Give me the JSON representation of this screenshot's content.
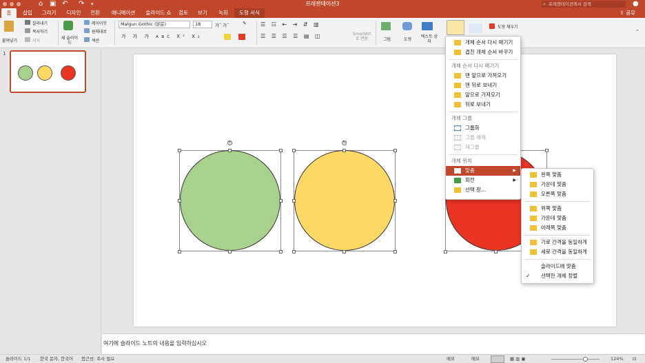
{
  "window": {
    "title": "프레젠테이션3",
    "search_placeholder": "프레젠테이션에서 검색",
    "share_label": "공유"
  },
  "tabs": [
    {
      "label": "홈",
      "active": true
    },
    {
      "label": "삽입"
    },
    {
      "label": "그리기"
    },
    {
      "label": "디자인"
    },
    {
      "label": "전환"
    },
    {
      "label": "애니메이션"
    },
    {
      "label": "슬라이드 쇼"
    },
    {
      "label": "검토"
    },
    {
      "label": "보기"
    },
    {
      "label": "녹화"
    },
    {
      "label": "도형 서식"
    }
  ],
  "ribbon": {
    "paste": "붙여넣기",
    "cut": "잘라내기",
    "copy": "복사하기",
    "format": "서식",
    "new_slide": "새 슬라이드",
    "layout": "레이아웃",
    "reset": "원래대로",
    "section": "섹션",
    "font_name": "Malgun Gothic (본문)",
    "font_size": "18",
    "smartart": "SmartArt로 변환",
    "picture": "그림",
    "shapes": "도형",
    "textbox": "텍스트 상자",
    "shape_fill": "도형 채우기"
  },
  "slide_panel": {
    "number": "1"
  },
  "notes_placeholder": "여기에 슬라이드 노트의 내용을 입력하십시오",
  "status": {
    "slide": "슬라이드 1/1",
    "language": "한국 문자, 한국어",
    "accessibility": "접근성: 조사 필요",
    "notes": "메모",
    "comments": "메모",
    "zoom": "124%"
  },
  "colors": {
    "accent": "#c0472b",
    "green": "#a9d18e",
    "yellow": "#ffd966",
    "red": "#e93323"
  },
  "arrange_menu": {
    "reorder": "개체 순서 다시 매기기",
    "reorder_overlap": "겹친 개체 순서 바꾸기",
    "hdr_order": "개체 순서 다시 매기기",
    "front": "맨 앞으로 가져오기",
    "back": "맨 뒤로 보내기",
    "forward": "앞으로 가져오기",
    "backward": "뒤로 보내기",
    "hdr_group": "개체 그룹",
    "group": "그룹화",
    "ungroup": "그룹 해제",
    "regroup": "재그룹",
    "hdr_position": "개체 위치",
    "align": "맞춤",
    "rotate": "회전",
    "selection_pane": "선택 창..."
  },
  "align_menu": {
    "left": "왼쪽 맞춤",
    "center": "가운데 맞춤",
    "right": "오른쪽 맞춤",
    "top": "위쪽 맞춤",
    "middle": "가운데 맞춤",
    "bottom": "아래쪽 맞춤",
    "distribute_h": "가로 간격을 동일하게",
    "distribute_v": "세로 간격을 동일하게",
    "to_slide": "슬라이드에 맞춤",
    "to_selected": "선택한 개체 정렬"
  }
}
